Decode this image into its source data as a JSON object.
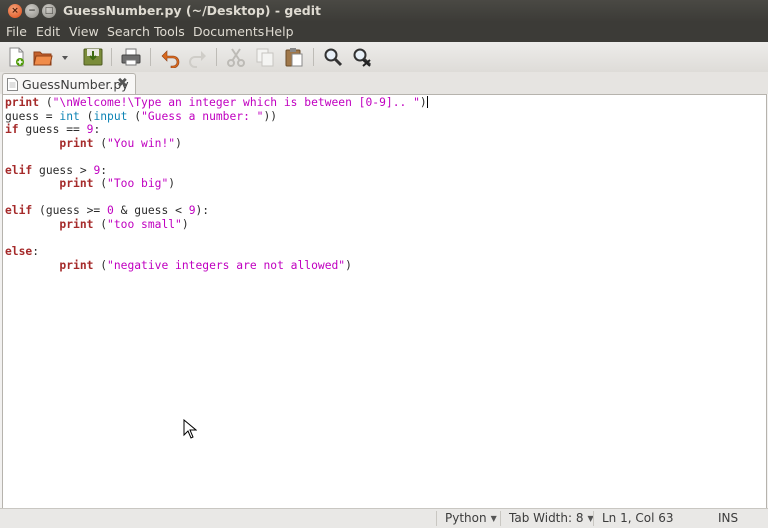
{
  "window": {
    "title": "GuessNumber.py (~/Desktop) - gedit",
    "close_glyph": "×",
    "minimize_glyph": "−",
    "maximize_glyph": "□"
  },
  "menu": [
    "File",
    "Edit",
    "View",
    "Search",
    "Tools",
    "Documents",
    "Help"
  ],
  "toolbar": {
    "icons": [
      "new-document-icon",
      "open-icon",
      "open-recent-dropdown-icon",
      "save-icon",
      "print-icon",
      "undo-icon",
      "redo-icon",
      "cut-icon",
      "copy-icon",
      "paste-icon",
      "find-icon",
      "find-replace-icon"
    ]
  },
  "tab": {
    "label": "GuessNumber.py",
    "close_glyph": "✖"
  },
  "code": [
    [
      "print",
      " (\"\\nWelcome!\\Type an integer which is between [0-9].. \")"
    ],
    [
      "guess = int (input (\"Guess a number: \"))"
    ],
    [
      "if",
      " guess == 9:"
    ],
    [
      "        print",
      " (\"You win!\")"
    ],
    [
      ""
    ],
    [
      "elif",
      " guess > 9:"
    ],
    [
      "        print",
      " (\"Too big\")"
    ],
    [
      ""
    ],
    [
      "elif",
      " (guess >= 0 & guess < 9):"
    ],
    [
      "        print",
      " (\"too small\")"
    ],
    [
      ""
    ],
    [
      "else",
      ":"
    ],
    [
      "        print",
      " (\"negative integers are not allowed\")"
    ]
  ],
  "status": {
    "language": "Python",
    "tab_width": "Tab Width:  8",
    "position": "Ln 1, Col 63",
    "mode": "INS"
  },
  "colors": {
    "keyword": "#a52a2a",
    "builtin": "#0e84b5",
    "string": "#c000c0",
    "number": "#c000c0",
    "titlebar": "#3c3b37"
  }
}
